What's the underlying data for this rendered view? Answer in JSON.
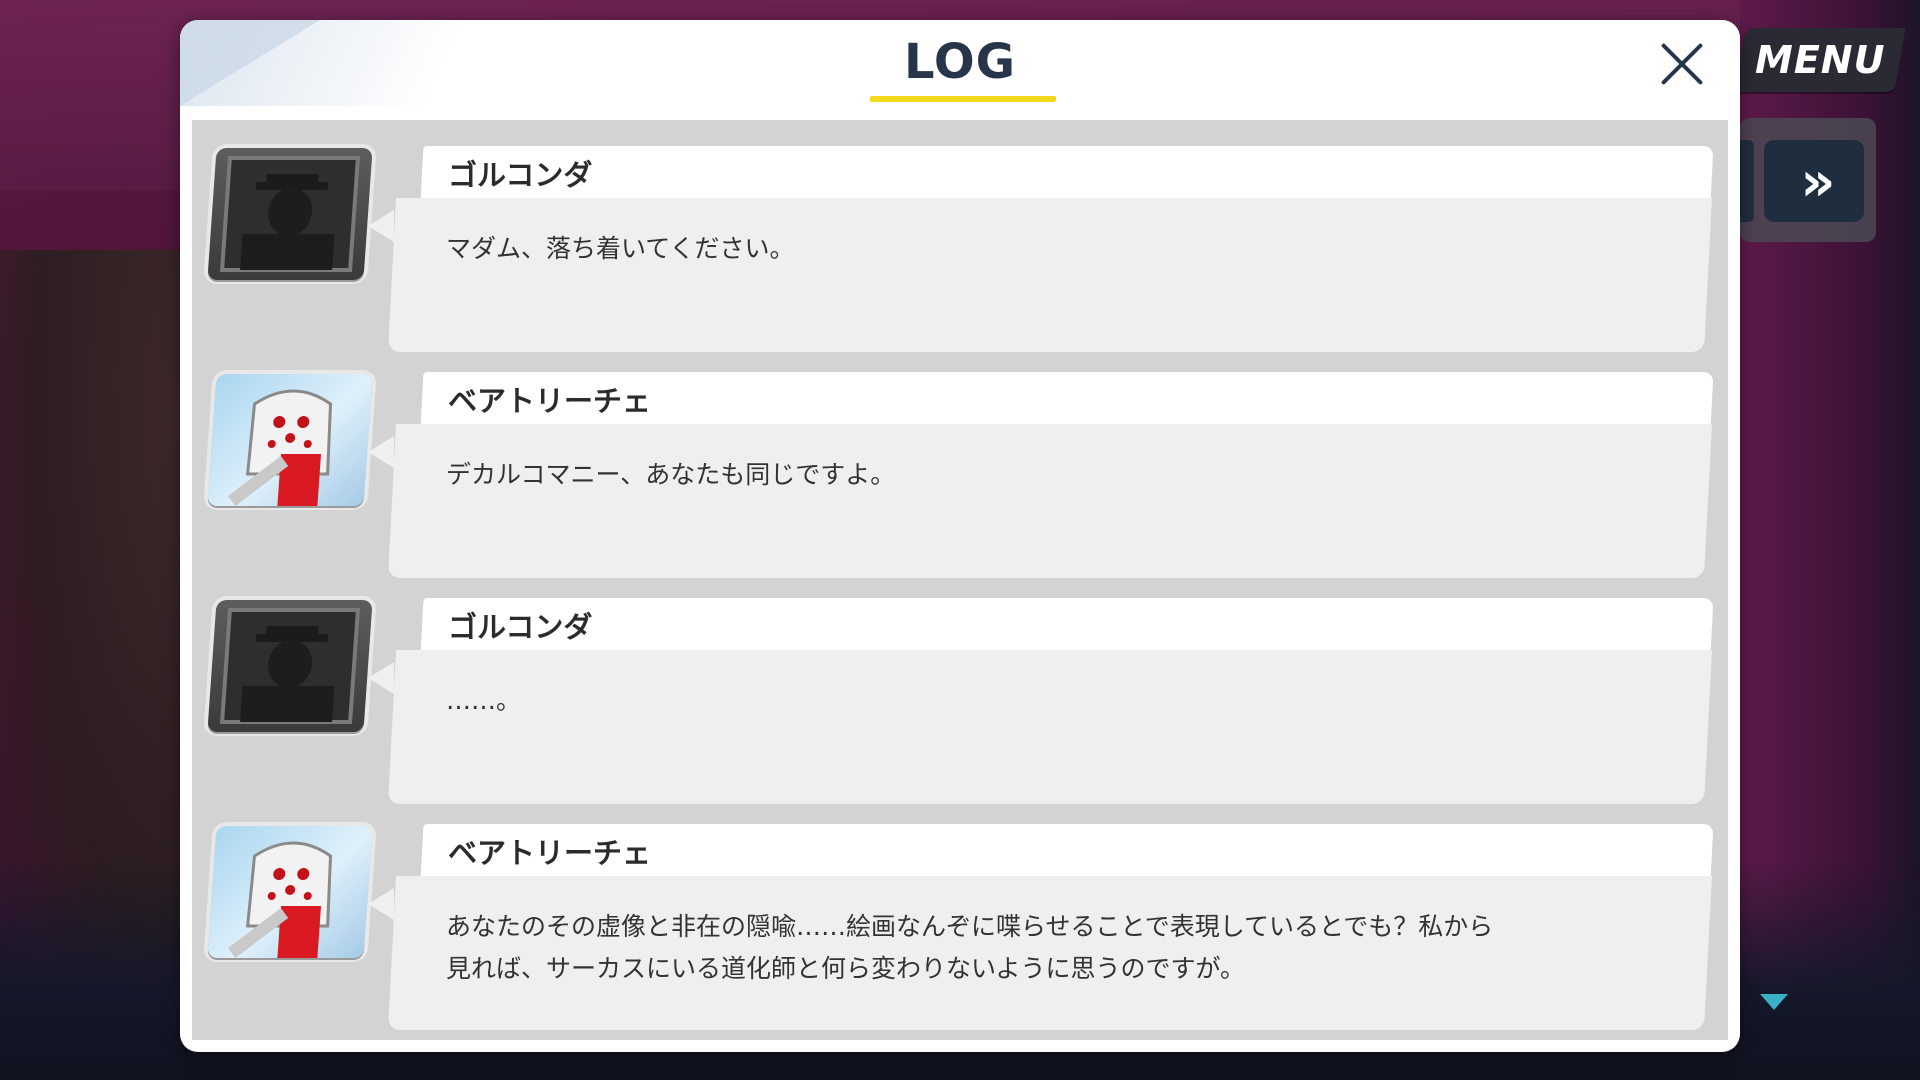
{
  "hud": {
    "menu_label": "MENU",
    "skip_label": "»"
  },
  "log": {
    "title": "LOG",
    "entries": [
      {
        "speaker": "ゴルコンダ",
        "avatar": "golconda",
        "message": "マダム、落ち着いてください。"
      },
      {
        "speaker": "ベアトリーチェ",
        "avatar": "beatrice",
        "message": "デカルコマニー、あなたも同じですよ。"
      },
      {
        "speaker": "ゴルコンダ",
        "avatar": "golconda",
        "message": "……。"
      },
      {
        "speaker": "ベアトリーチェ",
        "avatar": "beatrice",
        "message": "あなたのその虚像と非在の隠喩……絵画なんぞに喋らせることで表現しているとでも？私から\n見れば、サーカスにいる道化師と何ら変わりないように思うのですが。"
      }
    ]
  },
  "colors": {
    "title_text": "#27354a",
    "title_underline": "#f4d81c",
    "log_body": "#d3d3d3",
    "bubble": "#efefef",
    "scroll_arrow": "#3ab1c4"
  }
}
